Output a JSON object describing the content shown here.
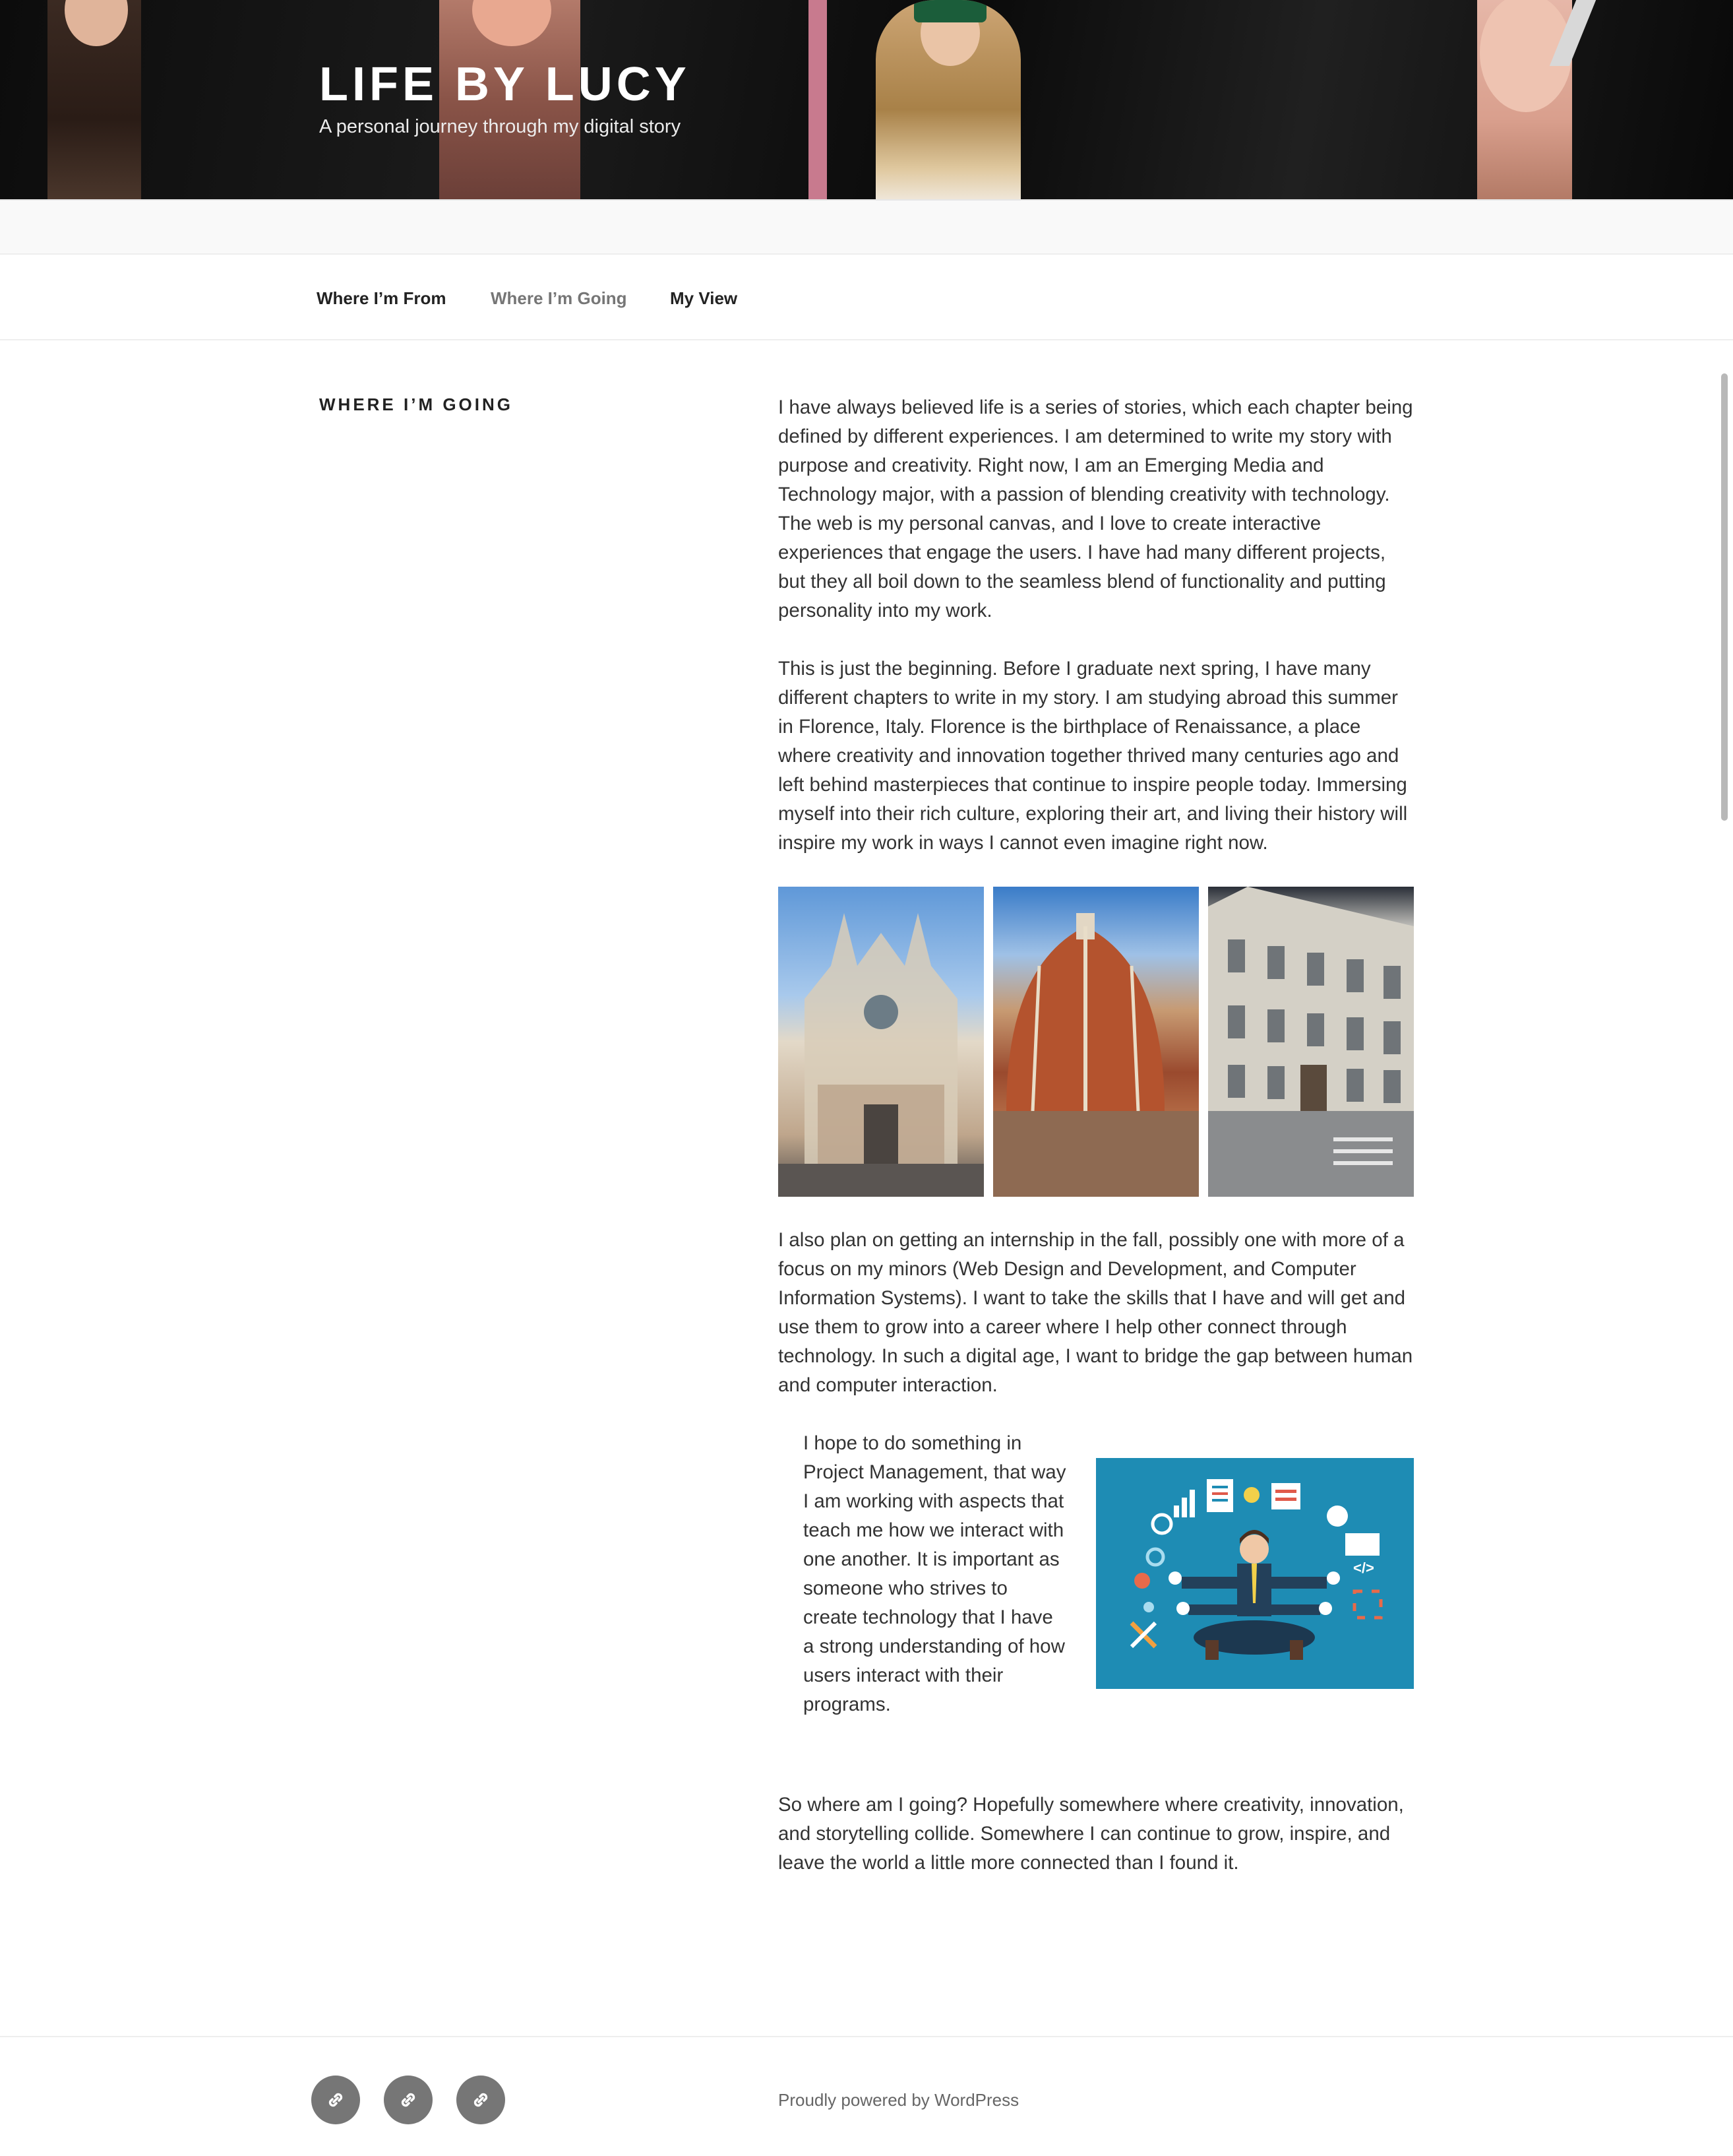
{
  "header": {
    "site_title": "LIFE BY LUCY",
    "site_description": "A personal journey through my digital story"
  },
  "nav": {
    "items": [
      {
        "label": "Where I’m From",
        "current": false
      },
      {
        "label": "Where I’m Going",
        "current": true
      },
      {
        "label": "My View",
        "current": false
      }
    ]
  },
  "page": {
    "title": "WHERE I’M GOING",
    "paragraphs": [
      "I have always believed life is a series of stories, which each chapter being defined by different experiences. I am determined to write my story with purpose and creativity. Right now, I am an Emerging Media and Technology major, with a passion of blending creativity with technology. The web is my personal canvas, and I love to create interactive experiences that engage the users. I have had many different projects, but they all boil down to the seamless blend of functionality and putting personality into my work.",
      "This is just the beginning. Before I graduate next spring, I have many different chapters to write in my story. I am studying abroad this summer in Florence, Italy. Florence is the birthplace of Renaissance, a place where creativity and innovation together thrived many centuries ago and left behind masterpieces that continue to inspire people today. Immersing myself into their rich culture, exploring their art, and living their history will inspire my work in ways I cannot even imagine right now.",
      "I also plan on getting an internship in the fall, possibly one with more of a focus on my minors (Web Design and Development, and Computer Information Systems). I want to take the skills that I have and will get and use them to grow into a career where I help other connect through technology. In such a digital age, I want to bridge the gap between human and computer interaction.",
      "So where am I going? Hopefully somewhere where creativity, innovation, and storytelling collide. Somewhere I can continue to grow, inspire, and leave the world a little more connected than I found it."
    ],
    "media_text": "I hope to do something in Project Management, that way I am working with aspects that teach me how we interact with one another. It is important as someone who strives to create technology that I have a strong understanding of how users interact with their programs."
  },
  "gallery": {
    "images": [
      "cathedral-facade-photo",
      "duomo-dome-photo",
      "florence-building-photo"
    ]
  },
  "footer": {
    "social_icons": [
      "link-icon",
      "link-icon",
      "link-icon"
    ],
    "powered_by": "Proudly powered by WordPress"
  },
  "colors": {
    "header_bg": "#111111",
    "nav_current": "#767676",
    "text": "#333333",
    "social_icon_bg": "#767676",
    "media_bg": "#1e8cb4"
  }
}
